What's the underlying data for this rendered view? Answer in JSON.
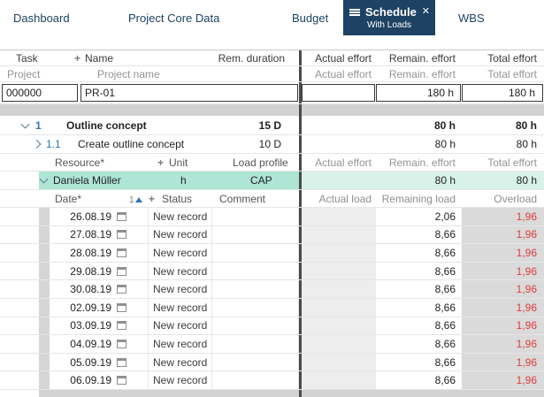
{
  "tabs": {
    "items": [
      {
        "label": "Dashboard"
      },
      {
        "label": "Project Core Data"
      },
      {
        "label": "Budget"
      },
      {
        "label": "Schedule",
        "sublabel": "With Loads",
        "active": true
      },
      {
        "label": "WBS"
      }
    ]
  },
  "header": {
    "task": "Task",
    "add": "+",
    "name": "Name",
    "rem_duration": "Rem. duration",
    "actual_effort": "Actual effort",
    "remain_effort": "Remain. effort",
    "total_effort": "Total effort"
  },
  "subheader": {
    "project": "Project",
    "project_name": "Project name",
    "actual_effort": "Actual effort",
    "remain_effort": "Remain. effort",
    "total_effort": "Total effort"
  },
  "project": {
    "id": "000000",
    "name": "PR-01",
    "actual_effort": "",
    "remain_effort": "180 h",
    "total_effort": "180 h"
  },
  "tasks": [
    {
      "number": "1",
      "name": "Outline concept",
      "rem_duration": "15 D",
      "actual_effort": "",
      "remain_effort": "80 h",
      "total_effort": "80 h",
      "expanded": true
    },
    {
      "number": "1.1",
      "name": "Create outline concept",
      "rem_duration": "10 D",
      "actual_effort": "",
      "remain_effort": "80 h",
      "total_effort": "80 h",
      "expanded": false
    }
  ],
  "resource_header": {
    "resource": "Resource*",
    "add": "+",
    "unit": "Unit",
    "load_profile": "Load profile",
    "actual_effort": "Actual effort",
    "remain_effort": "Remain. effort",
    "total_effort": "Total effort"
  },
  "resource": {
    "name": "Daniela Müller",
    "unit": "h",
    "load_profile": "CAP",
    "actual_effort": "",
    "remain_effort": "80 h",
    "total_effort": "80 h"
  },
  "loads_header": {
    "date": "Date*",
    "sort_order": "1",
    "add": "+",
    "status": "Status",
    "comment": "Comment",
    "actual_load": "Actual load",
    "remaining_load": "Remaining load",
    "overload": "Overload"
  },
  "loads": [
    {
      "date": "26.08.19",
      "status": "New record",
      "comment": "",
      "actual_load": "",
      "remaining_load": "2,06",
      "overload": "1,96"
    },
    {
      "date": "27.08.19",
      "status": "New record",
      "comment": "",
      "actual_load": "",
      "remaining_load": "8,66",
      "overload": "1,96"
    },
    {
      "date": "28.08.19",
      "status": "New record",
      "comment": "",
      "actual_load": "",
      "remaining_load": "8,66",
      "overload": "1,96"
    },
    {
      "date": "29.08.19",
      "status": "New record",
      "comment": "",
      "actual_load": "",
      "remaining_load": "8,66",
      "overload": "1,96"
    },
    {
      "date": "30.08.19",
      "status": "New record",
      "comment": "",
      "actual_load": "",
      "remaining_load": "8,66",
      "overload": "1,96"
    },
    {
      "date": "02.09.19",
      "status": "New record",
      "comment": "",
      "actual_load": "",
      "remaining_load": "8,66",
      "overload": "1,96"
    },
    {
      "date": "03.09.19",
      "status": "New record",
      "comment": "",
      "actual_load": "",
      "remaining_load": "8,66",
      "overload": "1,96"
    },
    {
      "date": "04.09.19",
      "status": "New record",
      "comment": "",
      "actual_load": "",
      "remaining_load": "8,66",
      "overload": "1,96"
    },
    {
      "date": "05.09.19",
      "status": "New record",
      "comment": "",
      "actual_load": "",
      "remaining_load": "8,66",
      "overload": "1,96"
    },
    {
      "date": "06.09.19",
      "status": "New record",
      "comment": "",
      "actual_load": "",
      "remaining_load": "8,66",
      "overload": "1,96"
    }
  ],
  "colors": {
    "active_tab": "#1d4264",
    "highlight_row": "#aee5d5",
    "overload_text": "#e03c3c",
    "divider": "#4a4a4a",
    "spacer": "#d2d2d2",
    "link_number": "#2e75b6"
  }
}
